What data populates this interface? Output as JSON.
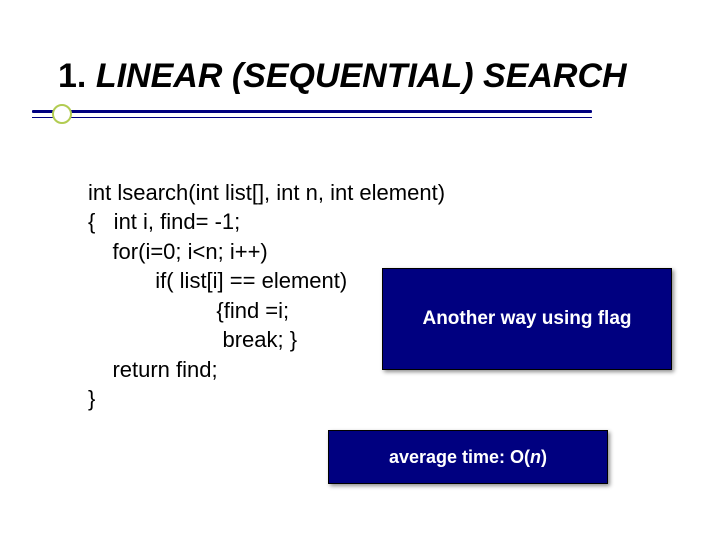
{
  "title": {
    "index": "1.",
    "text": "LINEAR (SEQUENTIAL) SEARCH"
  },
  "code": {
    "l1": "int lsearch(int list[], int n, int element)",
    "l2": "{   int i, find= -1;",
    "l3": "    for(i=0; i<n; i++)",
    "l4": "           if( list[i] == element)",
    "l5": "                     {find =i;",
    "l6": "                      break; }",
    "l7": "    return find;",
    "l8": "}"
  },
  "callouts": {
    "flag": "Another way using flag",
    "avg_prefix": "average time: O(",
    "avg_n": "n",
    "avg_suffix": ")"
  }
}
